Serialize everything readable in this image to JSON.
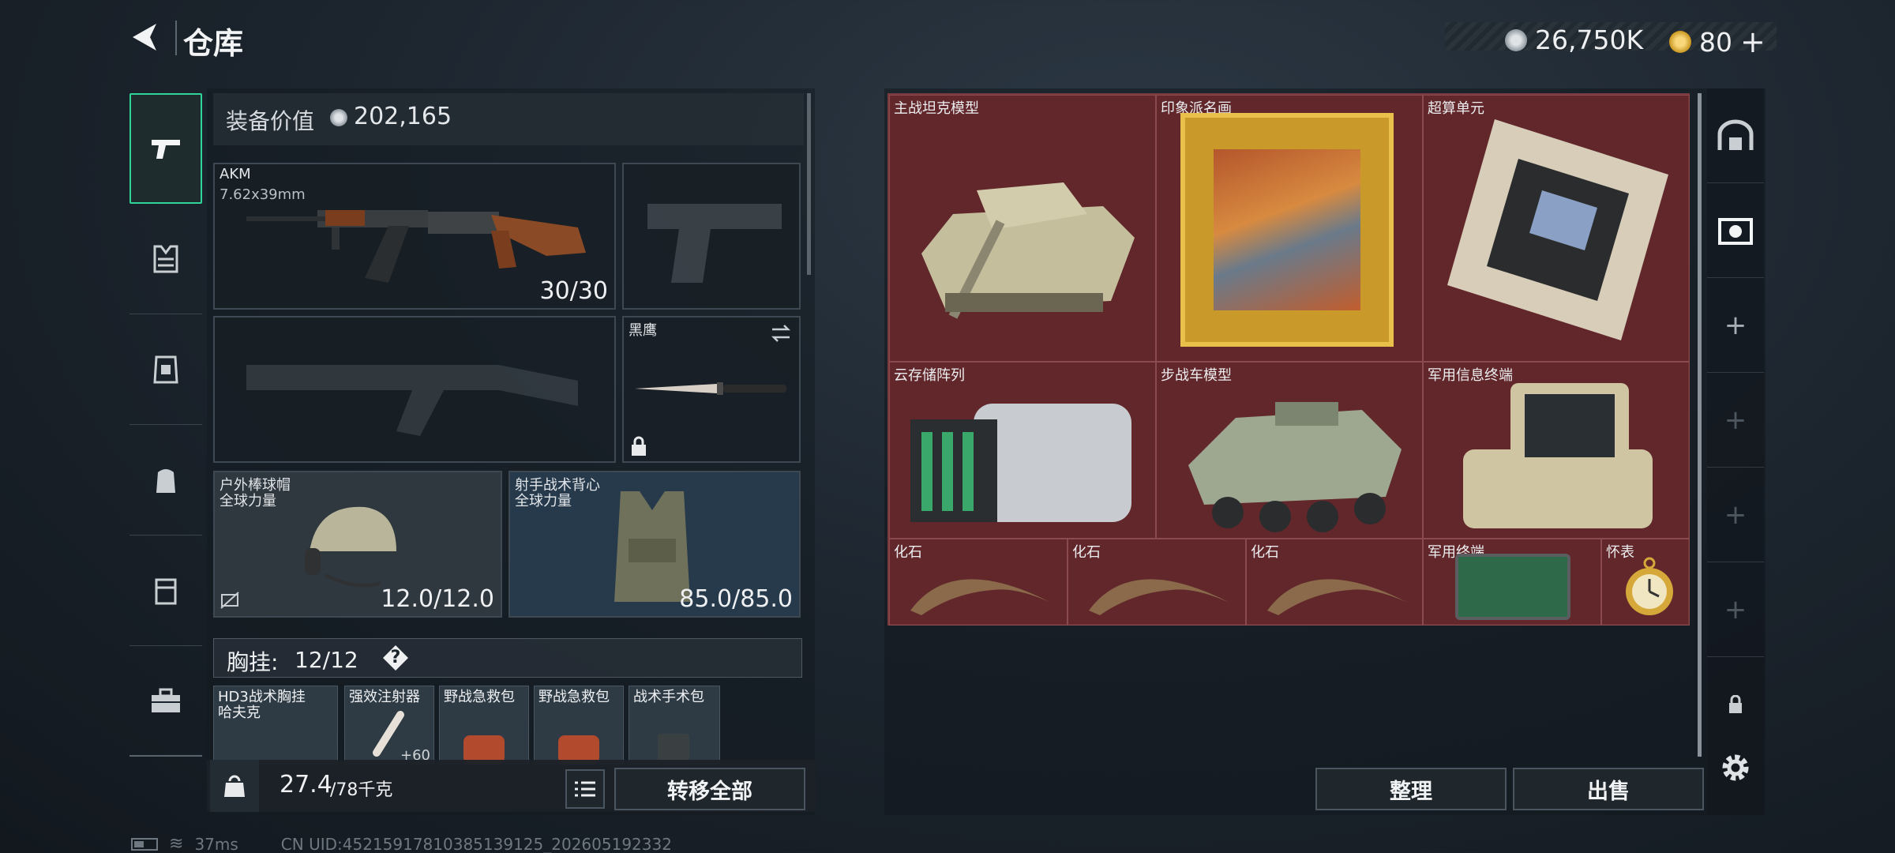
{
  "header": {
    "title": "仓库",
    "currency_money": "26,750K",
    "currency_coin": "80",
    "add_symbol": "+"
  },
  "left_tabs": [
    "gun-icon",
    "vest-icon",
    "armor-icon",
    "backpack-icon",
    "pouch-icon",
    "toolbox-icon"
  ],
  "equipment": {
    "value_label": "装备价值",
    "value": "202,165",
    "primary": {
      "name": "AKM",
      "ammo_type": "7.62x39mm",
      "ammo": "30/30"
    },
    "melee": {
      "name": "黑鹰"
    },
    "helmet": {
      "name": "户外棒球帽",
      "sub": "全球力量",
      "durability": "12.0/12.0"
    },
    "armor": {
      "name": "射手战术背心",
      "sub": "全球力量",
      "durability": "85.0/85.0"
    },
    "chest_rig": {
      "label": "胸挂:",
      "capacity": "12/12",
      "help": "?"
    },
    "rig_items": [
      {
        "name": "HD3战术胸挂",
        "sub": "哈夫克"
      },
      {
        "name": "强效注射器",
        "count": "+60"
      },
      {
        "name": "野战急救包"
      },
      {
        "name": "野战急救包"
      },
      {
        "name": "战术手术包"
      }
    ]
  },
  "bottom": {
    "weight": "27.4",
    "weight_max": "/78千克",
    "transfer_all": "转移全部",
    "sort": "整理",
    "sell": "出售"
  },
  "storage": [
    {
      "name": "主战坦克模型"
    },
    {
      "name": "印象派名画"
    },
    {
      "name": "超算单元"
    },
    {
      "name": "云存储阵列"
    },
    {
      "name": "步战车模型"
    },
    {
      "name": "军用信息终端"
    },
    {
      "name": "化石"
    },
    {
      "name": "化石"
    },
    {
      "name": "化石"
    },
    {
      "name": "军用终端"
    },
    {
      "name": "怀表"
    }
  ],
  "status_bar": {
    "ping": "37ms",
    "uid": "CN UID:452159178103851391​25_202605192332"
  },
  "colors": {
    "accent": "#2fd49a",
    "storage_bg": "#5a2528",
    "armor_slot": "#263a4c"
  }
}
